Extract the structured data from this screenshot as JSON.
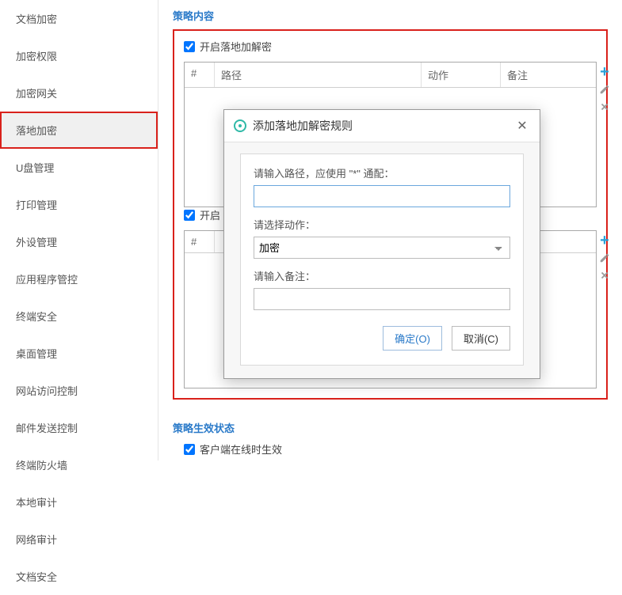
{
  "sidebar": {
    "items": [
      {
        "label": "文档加密"
      },
      {
        "label": "加密权限"
      },
      {
        "label": "加密网关"
      },
      {
        "label": "落地加密"
      },
      {
        "label": "U盘管理"
      },
      {
        "label": "打印管理"
      },
      {
        "label": "外设管理"
      },
      {
        "label": "应用程序管控"
      },
      {
        "label": "终端安全"
      },
      {
        "label": "桌面管理"
      },
      {
        "label": "网站访问控制"
      },
      {
        "label": "邮件发送控制"
      },
      {
        "label": "终端防火墙"
      },
      {
        "label": "本地审计"
      },
      {
        "label": "网络审计"
      },
      {
        "label": "文档安全"
      }
    ],
    "active_index": 3
  },
  "section": {
    "content_title": "策略内容",
    "enable_landing_label": "开启落地加解密",
    "enable_landing_checked": true,
    "open_prefix": "开启",
    "status_title": "策略生效状态",
    "client_online_label": "客户端在线时生效",
    "client_online_checked": true
  },
  "table1": {
    "headers": {
      "num": "#",
      "path": "路径",
      "action": "动作",
      "note": "备注"
    },
    "rows": []
  },
  "table2": {
    "headers": {
      "num": "#"
    },
    "rows": []
  },
  "modal": {
    "title": "添加落地加解密规则",
    "path_label": "请输入路径，应使用 \"*\" 通配：",
    "path_value": "",
    "action_label": "请选择动作：",
    "action_value": "加密",
    "note_label": "请输入备注：",
    "note_value": "",
    "ok_label": "确定(O)",
    "cancel_label": "取消(C)"
  }
}
